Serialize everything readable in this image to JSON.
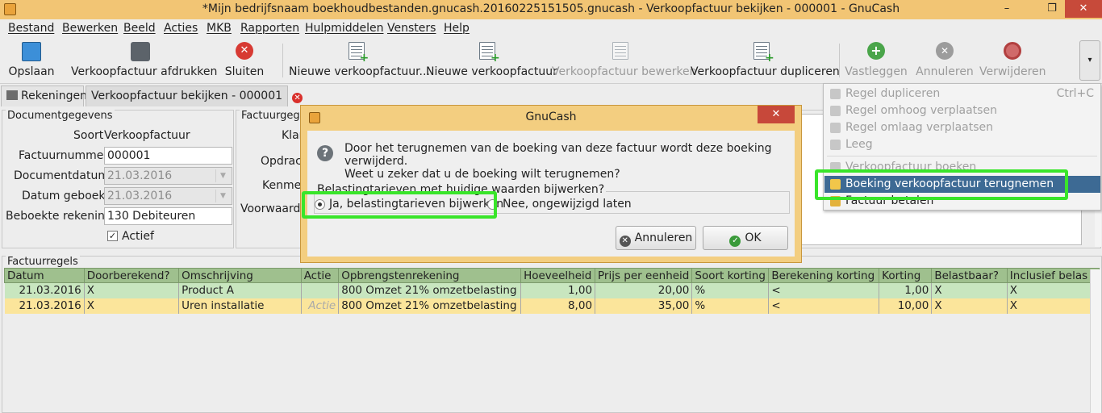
{
  "window": {
    "title": "*Mijn bedrijfsnaam boekhoudbestanden.gnucash.20160225151505.gnucash - Verkoopfactuur bekijken - 000001 - GnuCash",
    "minimize": "–",
    "restore": "❐",
    "close": "✕"
  },
  "menubar": [
    "Bestand",
    "Bewerken",
    "Beeld",
    "Acties",
    "MKB",
    "Rapporten",
    "Hulpmiddelen",
    "Vensters",
    "Help"
  ],
  "toolbar": {
    "save": "Opslaan",
    "print": "Verkoopfactuur afdrukken",
    "close": "Sluiten",
    "new_invoice_ellipsis": "Nieuwe verkoopfactuur...",
    "new_invoice": "Nieuwe verkoopfactuur",
    "edit_invoice": "Verkoopfactuur bewerken",
    "duplicate_invoice": "Verkoopfactuur dupliceren",
    "record": "Vastleggen",
    "cancel": "Annuleren",
    "delete": "Verwijderen",
    "overflow": "▾"
  },
  "tabs": {
    "accounts": "Rekeningen",
    "invoice": "Verkoopfactuur bekijken - 000001",
    "close_glyph": "✕"
  },
  "doc_panel": {
    "title": "Documentgegevens",
    "type_label": "Soort",
    "type_value": "Verkoopfactuur",
    "number_label": "Factuurnummer",
    "number_value": "000001",
    "date_label": "Documentdatum",
    "date_value": "21.03.2016",
    "posted_label": "Datum geboekt",
    "posted_value": "21.03.2016",
    "account_label": "Beboekte rekening",
    "account_value": "130 Debiteuren",
    "active_label": "Actief"
  },
  "fact_panel": {
    "title": "Factuurgeg",
    "klant": "Klan",
    "opdracht": "Opdrach",
    "kenmerk": "Kenme",
    "voorwaarden": "Voorwaarde"
  },
  "grid": {
    "title": "Factuurregels",
    "columns": [
      "Datum",
      "Doorberekend?",
      "Omschrijving",
      "Actie",
      "Opbrengstenrekening",
      "Hoeveelheid",
      "Prijs per eenheid",
      "Soort korting",
      "Berekening korting",
      "Korting",
      "Belastbaar?",
      "Inclusief belas"
    ],
    "rows": [
      [
        "21.03.2016",
        "X",
        "Product A",
        "",
        "800 Omzet 21% omzetbelasting",
        "1,00",
        "20,00",
        "%",
        "<",
        "1,00",
        "X",
        "X"
      ],
      [
        "21.03.2016",
        "X",
        "Uren installatie",
        "Actie",
        "800 Omzet 21% omzetbelasting",
        "8,00",
        "35,00",
        "%",
        "<",
        "10,00",
        "X",
        "X"
      ]
    ]
  },
  "dialog": {
    "title": "GnuCash",
    "close_glyph": "✕",
    "message_line1": "Door het terugnemen van de boeking van deze factuur wordt deze boeking verwijderd.",
    "message_line2": "Weet u zeker dat u de boeking wilt terugnemen?",
    "group_label": "Belastingtarieven met huidige waarden bijwerken?",
    "option_yes": "Ja, belastingtarieven bijwerken",
    "option_no": "Nee, ongewijzigd laten",
    "cancel_button": "Annuleren",
    "ok_button": "OK"
  },
  "popup_menu": {
    "duplicate_row": "Regel dupliceren",
    "duplicate_shortcut": "Ctrl+C",
    "move_up": "Regel omhoog verplaatsen",
    "move_down": "Regel omlaag verplaatsen",
    "clear": "Leeg",
    "post_invoice": "Verkoopfactuur boeken",
    "unpost_invoice": "Boeking verkoopfactuur terugnemen",
    "pay_invoice": "Factuur betalen"
  },
  "colors": {
    "titlebar": "#f2c574",
    "highlight": "#39e52a",
    "selected_menu": "#3d6a94",
    "row_green": "#c8e6bf",
    "row_yellow": "#fbe59b",
    "header_green": "#9fc08e"
  },
  "icons": [
    "app-icon",
    "save-icon",
    "print-icon",
    "close-icon",
    "new-invoice-icon",
    "edit-invoice-icon",
    "duplicate-icon",
    "record-icon",
    "cancel-icon",
    "delete-icon",
    "home-icon",
    "question-icon"
  ]
}
